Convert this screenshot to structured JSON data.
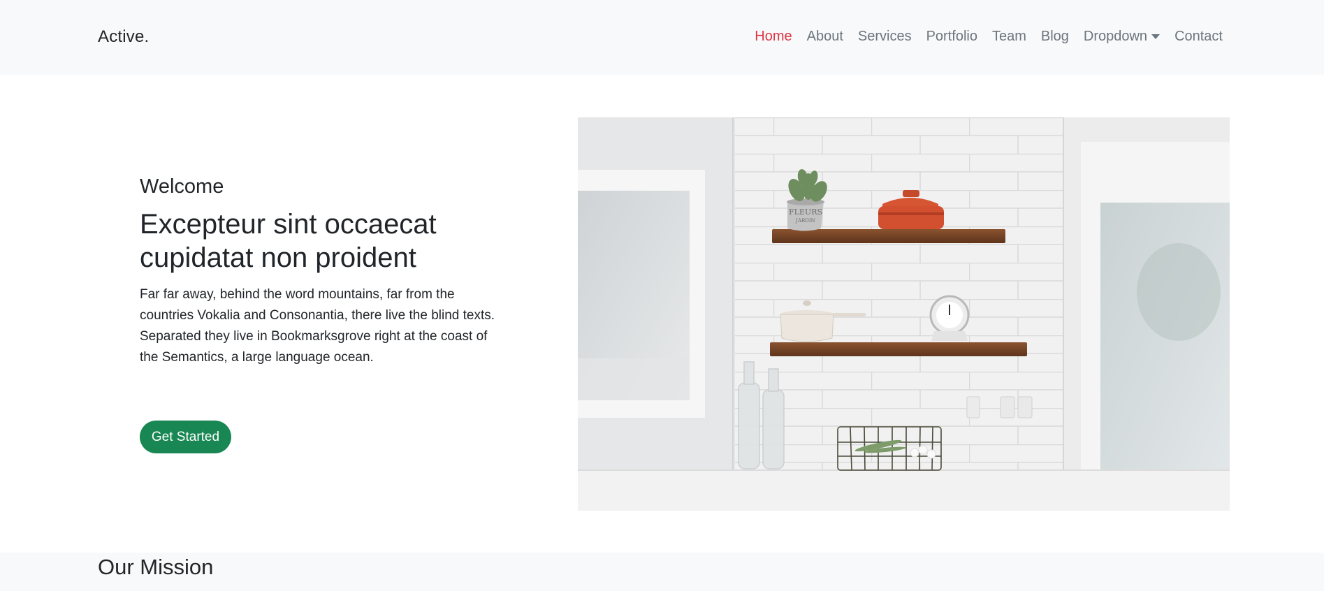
{
  "navbar": {
    "brand": "Active.",
    "items": [
      {
        "label": "Home",
        "active": true
      },
      {
        "label": "About"
      },
      {
        "label": "Services"
      },
      {
        "label": "Portfolio"
      },
      {
        "label": "Team"
      },
      {
        "label": "Blog"
      },
      {
        "label": "Dropdown",
        "has_caret": true
      },
      {
        "label": "Contact"
      }
    ]
  },
  "hero": {
    "welcome": "Welcome",
    "title": "Excepteur sint occaecat cupidatat non proident",
    "description": "Far far away, behind the word mountains, far from the countries Vokalia and Consonantia, there live the blind texts. Separated they live in Bookmarksgrove right at the coast of the Semantics, a large language ocean.",
    "cta_label": "Get Started",
    "image": {
      "pot_text": "FLEURS",
      "pot_subtext": "JARDIN"
    }
  },
  "mission": {
    "title": "Our Mission"
  },
  "colors": {
    "nav_bg": "#f8f9fa",
    "active_link": "#dc3545",
    "nav_link": "#6c757d",
    "cta": "#198754",
    "heading": "#212529"
  }
}
